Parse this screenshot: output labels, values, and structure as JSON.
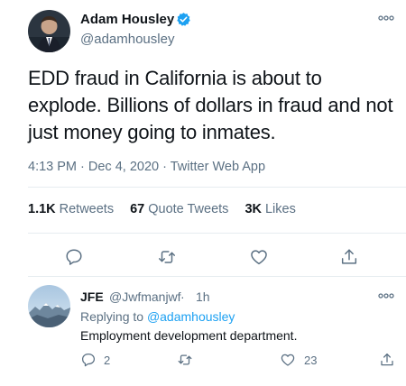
{
  "tweet": {
    "author_name": "Adam Housley",
    "author_handle": "@adamhousley",
    "text": "EDD fraud in California is about to explode. Billions of dollars in fraud and not just money going to inmates.",
    "time": "4:13 PM",
    "date": "Dec 4, 2020",
    "source": "Twitter Web App",
    "stats": {
      "retweets_count": "1.1K",
      "retweets_label": "Retweets",
      "quotes_count": "67",
      "quotes_label": "Quote Tweets",
      "likes_count": "3K",
      "likes_label": "Likes"
    }
  },
  "reply": {
    "author_name": "JFE",
    "author_handle": "@Jwfmanjwf",
    "time": "1h",
    "replying_prefix": "Replying to",
    "replying_to": "@adamhousley",
    "text": "Employment development department.",
    "reply_count": "2",
    "like_count": "23"
  },
  "colors": {
    "accent": "#1da1f2",
    "muted": "#5b7083",
    "divider": "#e6ecf0"
  },
  "icons": [
    "verified-badge-icon",
    "more-icon",
    "reply-icon",
    "retweet-icon",
    "like-icon",
    "share-icon"
  ]
}
